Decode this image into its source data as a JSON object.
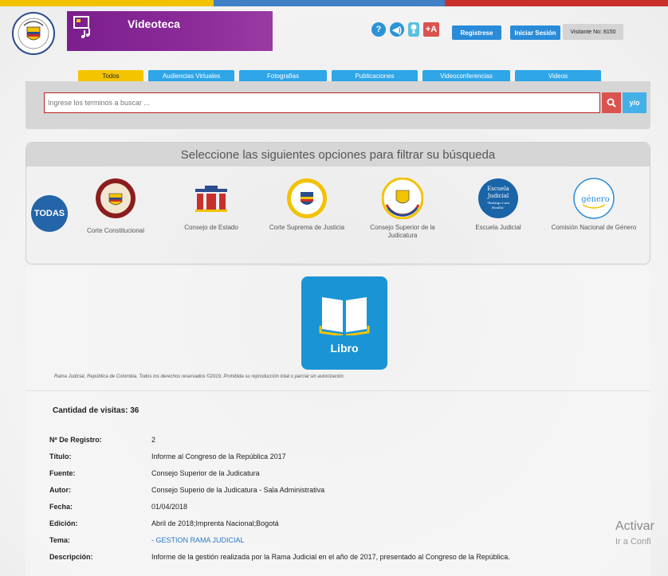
{
  "header": {
    "app_title": "Videoteca",
    "register_label": "Registrese",
    "login_label": "Iniciar Sesión",
    "visitor_label": "Visitante No: 8150",
    "colors": {
      "brand_purple": "#7b1e8e",
      "accent_blue": "#2a8bd8",
      "accent_red": "#d9534f",
      "accent_yellow": "#f5c400"
    }
  },
  "tabs": [
    {
      "label": "Todos",
      "active": true
    },
    {
      "label": "Audiencias Virtuales",
      "active": false
    },
    {
      "label": "Fotografias",
      "active": false
    },
    {
      "label": "Publicaciones",
      "active": false
    },
    {
      "label": "Videoconferencias",
      "active": false
    },
    {
      "label": "Videos",
      "active": false
    }
  ],
  "search": {
    "placeholder": "Ingrese los terminos a buscar ...",
    "value": "",
    "yo_label": "y/o"
  },
  "filter": {
    "heading": "Seleccione las siguientes opciones para filtrar su búsqueda",
    "all_label": "TODAS",
    "entities": [
      {
        "name": "Corte Constitucional"
      },
      {
        "name": "Consejo de Estado"
      },
      {
        "name": "Corte Suprema de Justicia"
      },
      {
        "name": "Consejo Superior de la Judicatura"
      },
      {
        "name": "Escuela Judicial"
      },
      {
        "name": "Comisión Nacional de Género"
      }
    ],
    "escuela_logo_text": [
      "Escuela",
      "Judicial",
      "\"Rodrigo Lara",
      "Bonilla\""
    ],
    "genero_logo_text": "género"
  },
  "item": {
    "media_type": "Libro",
    "copyright": "Rama Judicial, República de Colombia. Todos los derechos reservados ©2019, Prohibida su reproducción total o parcial sin autorización.",
    "visits_label": "Cantidad de visitas:",
    "visits_value": "36",
    "fields": [
      {
        "key": "Nº De Registro:",
        "value": "2"
      },
      {
        "key": "Título:",
        "value": "Informe al Congreso de la República 2017"
      },
      {
        "key": "Fuente:",
        "value": "Consejo Superior de la Judicatura"
      },
      {
        "key": "Autor:",
        "value": "Consejo Superio de la Judicatura - Sala Administrativa"
      },
      {
        "key": "Fecha:",
        "value": "01/04/2018"
      },
      {
        "key": "Edición:",
        "value": "Abril de 2018;Imprenta Nacional;Bogotá"
      },
      {
        "key": "Tema:",
        "value": "- GESTION RAMA JUDICIAL"
      },
      {
        "key": "Descripción:",
        "value": "Informe de la gestión realizada por la Rama Judicial en el año de 2017, presentado al Congreso de la República."
      }
    ]
  },
  "os_watermark": {
    "line1": "Activar",
    "line2": "Ir a Confi"
  }
}
